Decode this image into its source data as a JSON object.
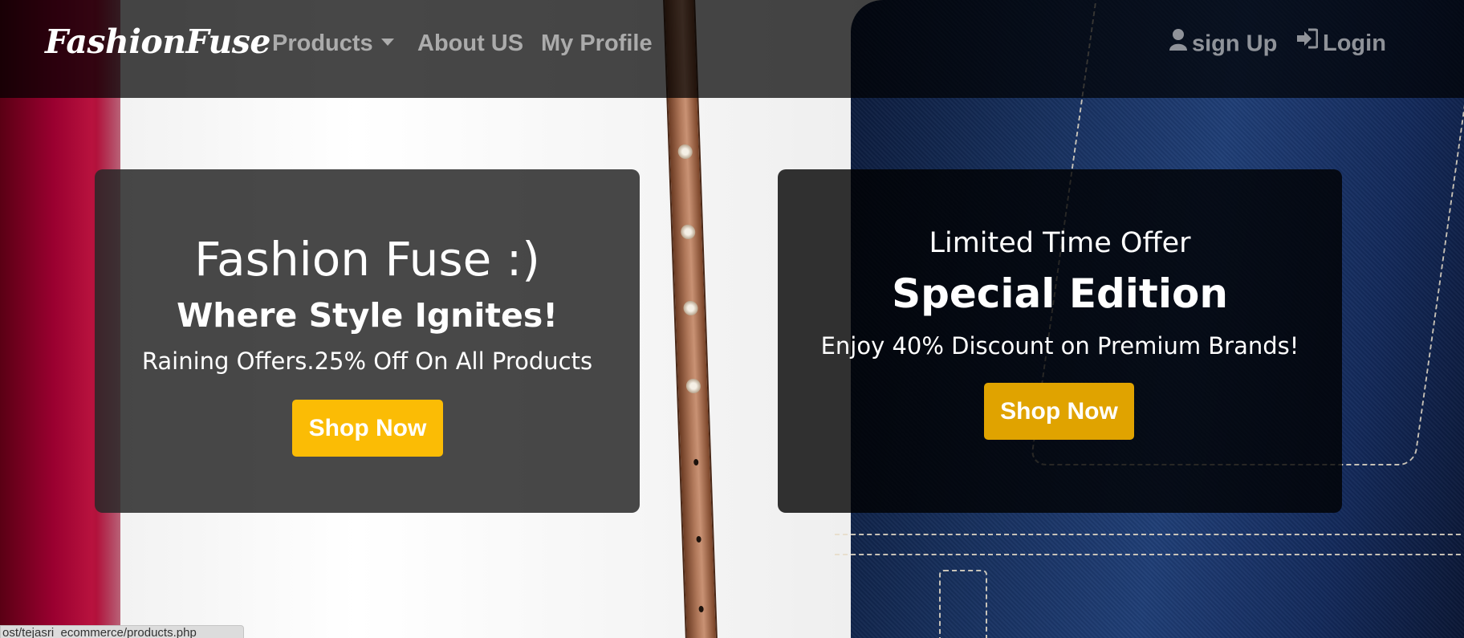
{
  "navbar": {
    "brand": "FashionFuse",
    "items": [
      {
        "label": "Products"
      },
      {
        "label": "About US"
      },
      {
        "label": "My Profile"
      }
    ],
    "signup_label": "sign Up",
    "login_label": "Login"
  },
  "hero_left": {
    "title": "Fashion Fuse :)",
    "subtitle": "Where Style Ignites!",
    "text": "Raining Offers.25% Off On All Products",
    "button_label": "Shop Now"
  },
  "hero_right": {
    "label": "Limited Time Offer",
    "title": "Special Edition",
    "text": "Enjoy 40% Discount on Premium Brands!",
    "button_label": "Shop Now"
  },
  "status_bar": {
    "url": "ost/tejasri_ecommerce/products.php"
  },
  "colors": {
    "navbar_bg": "#000000",
    "button_primary": "#fbbc05",
    "button_secondary": "#e0a300",
    "text_light": "#ffffff"
  },
  "icons": {
    "products_dropdown": "caret-down-icon",
    "signup": "user-icon",
    "login": "sign-in-icon"
  }
}
